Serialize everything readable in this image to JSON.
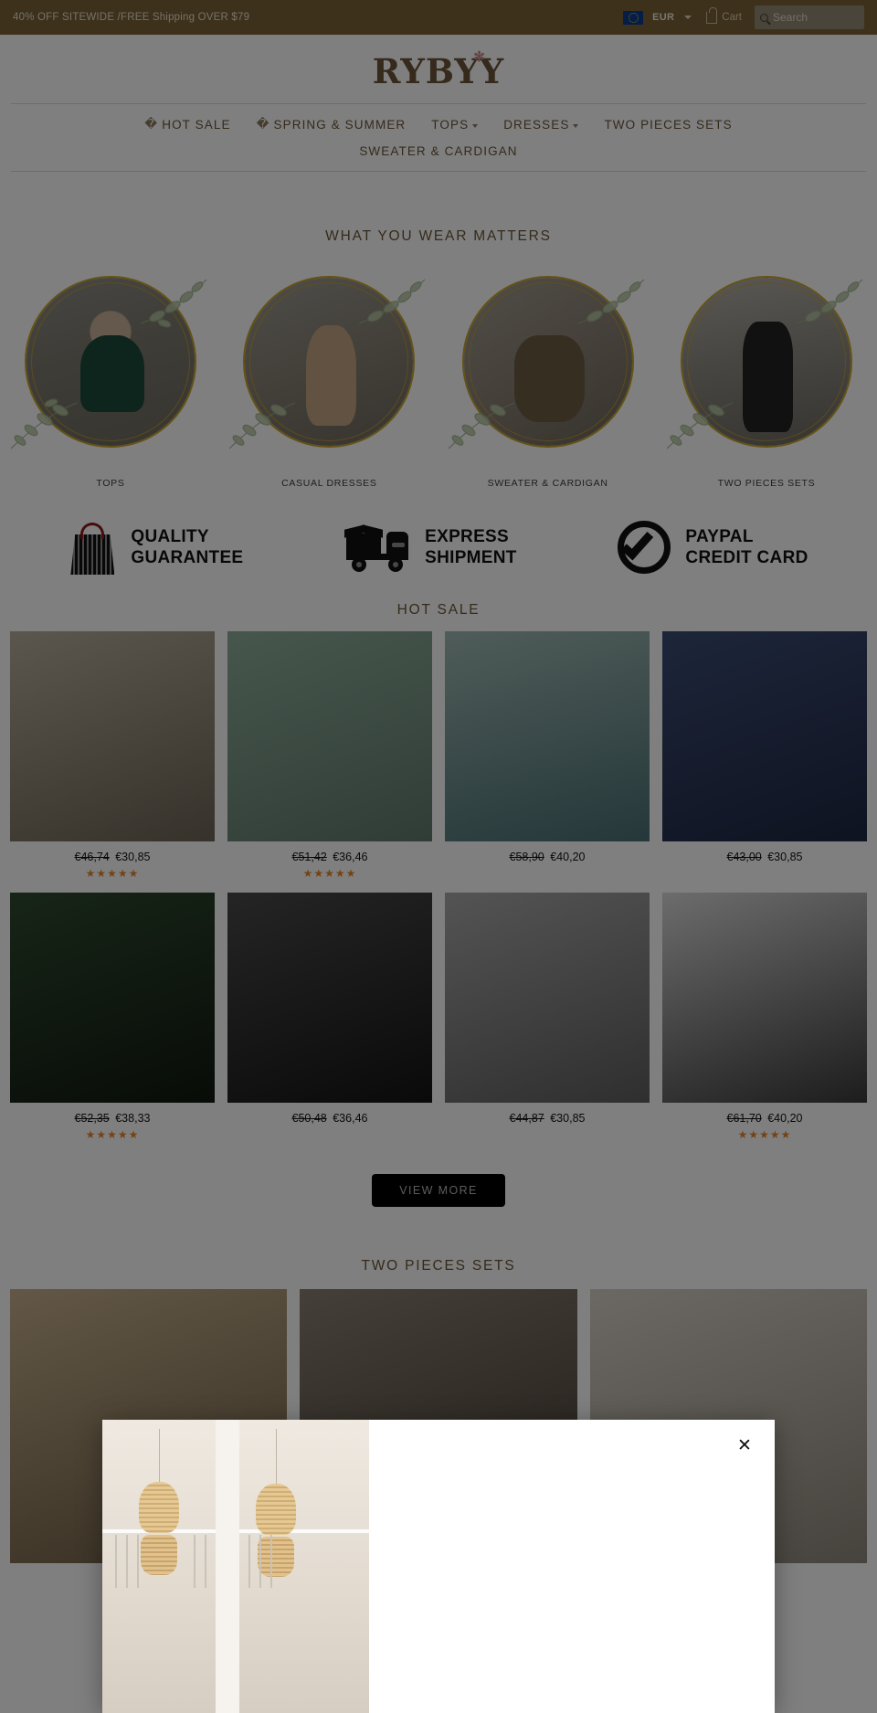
{
  "topbar": {
    "promo": "40% OFF SITEWIDE /FREE Shipping OVER $79",
    "currency": "EUR",
    "flag_icon": "eu-flag-icon",
    "chevron_icon": "chevron-down-icon",
    "cart_label": "Cart",
    "cart_icon": "cart-icon",
    "search_icon": "search-icon",
    "search_placeholder": "Search",
    "search_value": ""
  },
  "header": {
    "logo": "RYBYY",
    "flower_icon": "flower-icon"
  },
  "nav": {
    "row1": [
      {
        "label": "HOT SALE",
        "prefix": "�",
        "caret": false
      },
      {
        "label": "SPRING & SUMMER",
        "prefix": "�",
        "caret": false
      },
      {
        "label": "TOPS",
        "prefix": "",
        "caret": true
      },
      {
        "label": "DRESSES",
        "prefix": "",
        "caret": true
      },
      {
        "label": "TWO PIECES SETS",
        "prefix": "",
        "caret": false
      }
    ],
    "row2": [
      {
        "label": "SWEATER & CARDIGAN",
        "prefix": "",
        "caret": false
      }
    ]
  },
  "categories": {
    "title": "WHAT YOU WEAR MATTERS",
    "items": [
      {
        "label": "TOPS"
      },
      {
        "label": "CASUAL DRESSES"
      },
      {
        "label": "SWEATER & CARDIGAN"
      },
      {
        "label": "TWO PIECES SETS"
      }
    ]
  },
  "badges": [
    {
      "icon": "shopping-bag-icon",
      "line1": "QUALITY",
      "line2": "GUARANTEE"
    },
    {
      "icon": "delivery-truck-icon",
      "line1": "EXPRESS",
      "line2": "SHIPMENT"
    },
    {
      "icon": "check-circle-icon",
      "line1": "PAYPAL",
      "line2": "CREDIT CARD"
    }
  ],
  "hot_sale": {
    "title": "HOT SALE",
    "view_more": "VIEW MORE",
    "products": [
      {
        "old_price": "€46,74",
        "new_price": "€30,85",
        "stars": "★★★★★"
      },
      {
        "old_price": "€51,42",
        "new_price": "€36,46",
        "stars": "★★★★★"
      },
      {
        "old_price": "€58,90",
        "new_price": "€40,20",
        "stars": ""
      },
      {
        "old_price": "€43,00",
        "new_price": "€30,85",
        "stars": ""
      },
      {
        "old_price": "€52,35",
        "new_price": "€38,33",
        "stars": "★★★★★"
      },
      {
        "old_price": "€50,48",
        "new_price": "€36,46",
        "stars": ""
      },
      {
        "old_price": "€44,87",
        "new_price": "€30,85",
        "stars": ""
      },
      {
        "old_price": "€61,70",
        "new_price": "€40,20",
        "stars": "★★★★★"
      }
    ]
  },
  "two_pieces": {
    "title": "TWO PIECES SETS"
  },
  "modal": {
    "close_label": "✕",
    "close_icon": "close-icon"
  },
  "colors": {
    "brand_brown": "#6b5536",
    "topbar": "#7a6337",
    "gold": "#c9a227",
    "star": "#e8862b"
  }
}
